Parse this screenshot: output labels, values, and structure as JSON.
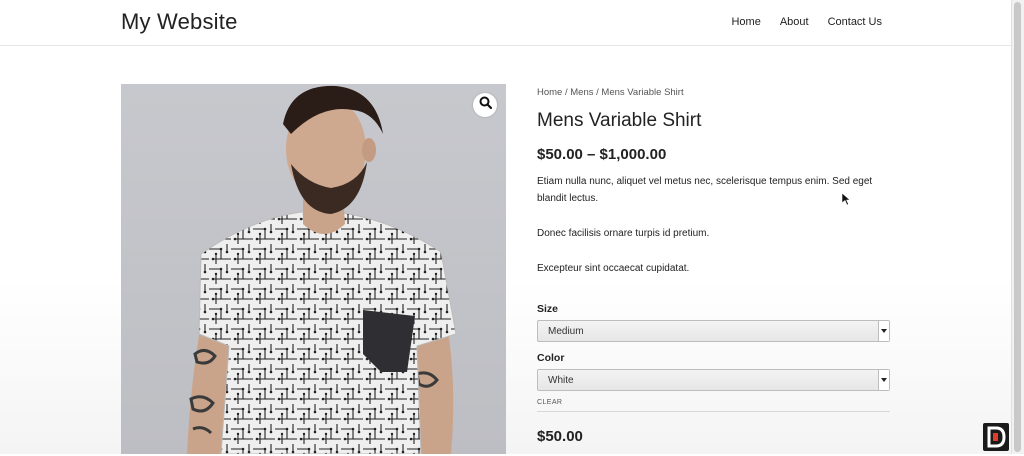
{
  "header": {
    "site_title": "My Website",
    "nav": [
      "Home",
      "About",
      "Contact Us"
    ]
  },
  "product": {
    "breadcrumb": "Home / Mens / Mens Variable Shirt",
    "title": "Mens Variable Shirt",
    "price_range": "$50.00 – $1,000.00",
    "description": [
      "Etiam nulla nunc, aliquet vel metus nec, scelerisque tempus enim. Sed eget blandit lectus.",
      "Donec facilisis ornare turpis id pretium.",
      "Excepteur sint occaecat cupidatat."
    ],
    "variations": {
      "size_label": "Size",
      "size_value": "Medium",
      "color_label": "Color",
      "color_value": "White",
      "clear_label": "CLEAR"
    },
    "selected_price": "$50.00"
  },
  "icons": {
    "zoom": "search-icon",
    "select_arrow": "chevron-down-icon",
    "badge": "channel-logo-icon"
  },
  "colors": {
    "text": "#222222",
    "image_bg": "#c4c5ca",
    "badge_bg": "#1a1a1a",
    "badge_accent": "#e23b2a"
  }
}
